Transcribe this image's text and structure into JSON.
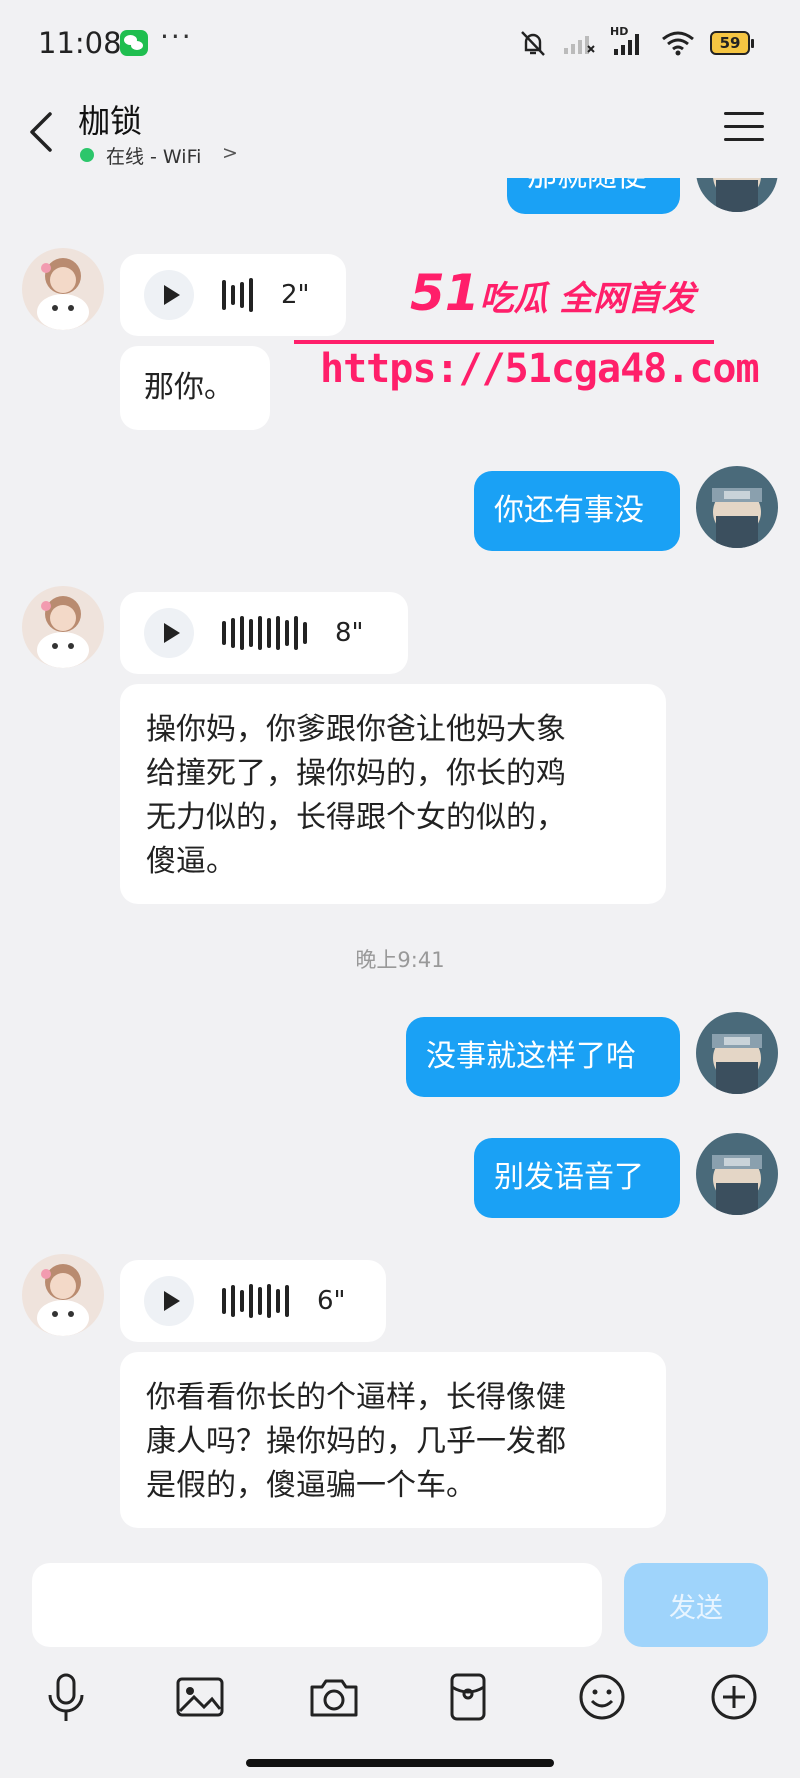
{
  "status_bar": {
    "time": "11:08",
    "more": "···",
    "network_label": "HD",
    "battery": "59",
    "icons": [
      "wechat-icon",
      "mute-bell-icon",
      "signal-icon",
      "signal-hd-icon",
      "wifi-icon",
      "battery-icon"
    ]
  },
  "header": {
    "contact_name": "枷锁",
    "presence": "在线 - WiFi",
    "presence_chevron": ">",
    "online_color": "#2cc66b"
  },
  "colors": {
    "outgoing_bubble": "#1aa1f5",
    "incoming_bubble": "#ffffff",
    "background": "#f1f1f3",
    "send_button": "#9fd4fb",
    "watermark": "#ff1f6a"
  },
  "watermark": {
    "brand_num": "51",
    "brand_text": "吃瓜 全网首发",
    "url": "https://51cga48.com"
  },
  "messages": {
    "m0": {
      "direction": "outgoing",
      "text": "那就随便"
    },
    "m1": {
      "direction": "incoming",
      "type": "voice",
      "duration": "2\""
    },
    "m2": {
      "direction": "incoming",
      "text": "那你。"
    },
    "m3": {
      "direction": "outgoing",
      "text": "你还有事没"
    },
    "m4": {
      "direction": "incoming",
      "type": "voice",
      "duration": "8\""
    },
    "m5": {
      "direction": "incoming",
      "lines": [
        "操你妈，你爹跟你爸让他妈大象",
        "给撞死了，操你妈的，你长的鸡",
        "无力似的，长得跟个女的似的，",
        "傻逼。"
      ]
    },
    "timestamp": "晚上9:41",
    "m6": {
      "direction": "outgoing",
      "text": "没事就这样了哈"
    },
    "m7": {
      "direction": "outgoing",
      "text": "别发语音了"
    },
    "m8": {
      "direction": "incoming",
      "type": "voice",
      "duration": "6\""
    },
    "m9": {
      "direction": "incoming",
      "lines": [
        "你看看你长的个逼样，长得像健",
        "康人吗？操你妈的，几乎一发都",
        "是假的，傻逼骗一个车。"
      ]
    }
  },
  "composer": {
    "input_value": "",
    "send_label": "发送",
    "tools": [
      "microphone-icon",
      "image-icon",
      "camera-icon",
      "red-packet-icon",
      "emoji-icon",
      "plus-icon"
    ]
  }
}
